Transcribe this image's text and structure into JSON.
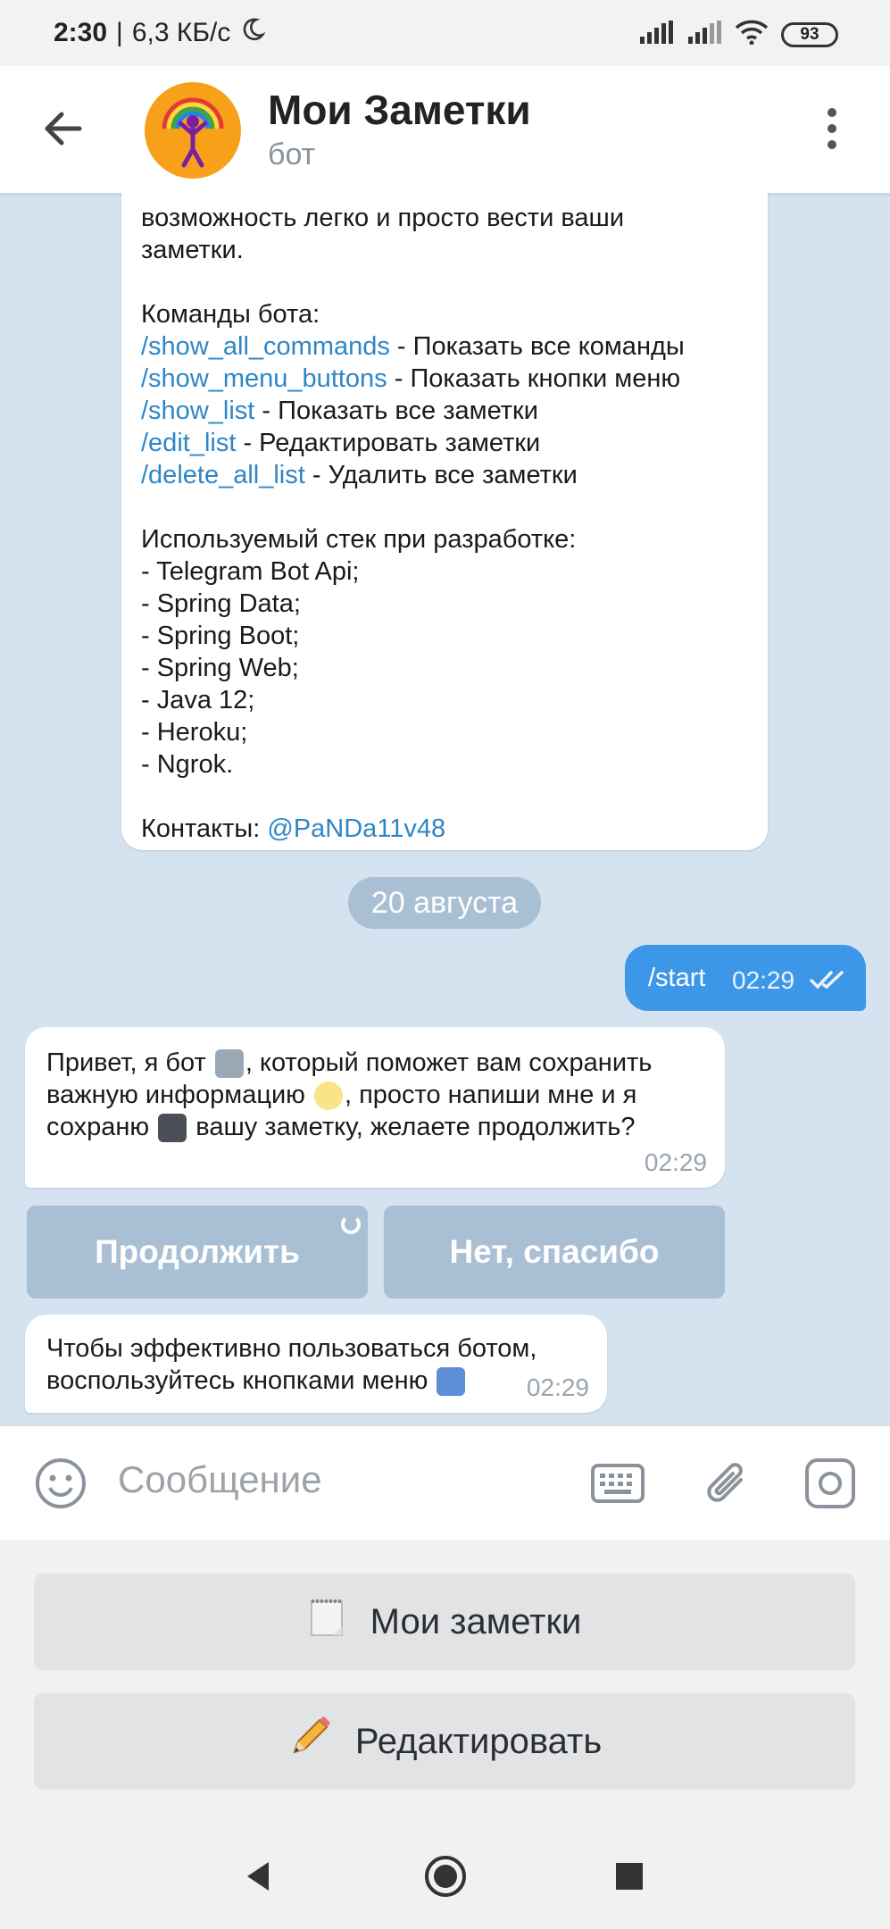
{
  "status_bar": {
    "time": "2:30",
    "separator": "|",
    "speed": "6,3 КБ/с",
    "battery": "93",
    "moon_icon": "moon-icon"
  },
  "header": {
    "title": "Мои Заметки",
    "subtitle": "бот",
    "back_icon": "arrow-left-icon",
    "menu_icon": "more-vert-icon"
  },
  "intro_message": {
    "line1": "возможность легко и просто вести ваши",
    "line2": "заметки.",
    "commands_title": "Команды бота:",
    "commands": [
      {
        "cmd": "/show_all_commands",
        "desc": " - Показать все команды"
      },
      {
        "cmd": "/show_menu_buttons",
        "desc": " - Показать кнопки меню"
      },
      {
        "cmd": "/show_list",
        "desc": " - Показать все заметки"
      },
      {
        "cmd": "/edit_list",
        "desc": " - Редактировать заметки"
      },
      {
        "cmd": "/delete_all_list",
        "desc": " - Удалить все заметки"
      }
    ],
    "stack_title": "Используемый стек при разработке:",
    "stack": [
      "- Telegram Bot Api;",
      "- Spring Data;",
      "- Spring Boot;",
      "- Spring Web;",
      "- Java 12;",
      "- Heroku;",
      "- Ngrok."
    ],
    "contacts_label": "Контакты: ",
    "contacts_handle": "@PaNDa11v48"
  },
  "date_chip": "20 августа",
  "out_message": {
    "text": "/start",
    "time": "02:29"
  },
  "bot_message": {
    "part1": "Привет, я бот ",
    "part2": ", который поможет вам сохранить",
    "part3": "важную информацию ",
    "part4": ", просто напиши мне и я",
    "part5": "сохраню ",
    "part6": " вашу заметку, желаете продолжить?",
    "time": "02:29"
  },
  "inline_buttons": {
    "continue": "Продолжить",
    "no_thanks": "Нет, спасибо"
  },
  "hint_message": {
    "line1": "Чтобы эффективно пользоваться ботом,",
    "line2": "воспользуйтесь кнопками меню ",
    "time": "02:29"
  },
  "input": {
    "placeholder": "Сообщение"
  },
  "reply_keyboard": {
    "my_notes": "Мои заметки",
    "edit": "Редактировать"
  },
  "colors": {
    "accent": "#3d97e8",
    "link": "#2f86c7",
    "chat_bg": "#d5e2ef",
    "inline_button": "#a9bfd3"
  }
}
